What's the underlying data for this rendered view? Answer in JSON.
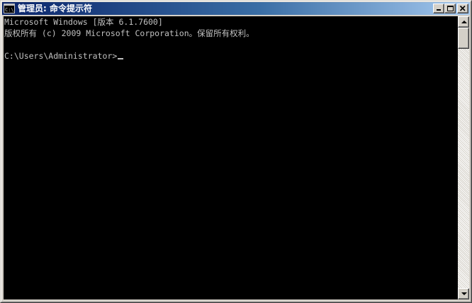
{
  "window": {
    "title": "管理员: 命令提示符",
    "icon": "cmd-icon",
    "icon_label": "C:\\",
    "controls": {
      "minimize": "minimize-icon",
      "maximize": "maximize-icon",
      "close": "close-icon"
    }
  },
  "console": {
    "lines": [
      "Microsoft Windows [版本 6.1.7600]",
      "版权所有 (c) 2009 Microsoft Corporation。保留所有权利。",
      "",
      "C:\\Users\\Administrator>"
    ],
    "foreground": "#c0c0c0",
    "background": "#000000"
  },
  "colors": {
    "titlebar_start": "#0a246a",
    "titlebar_end": "#a6caf0",
    "chrome": "#d4d0c8"
  }
}
